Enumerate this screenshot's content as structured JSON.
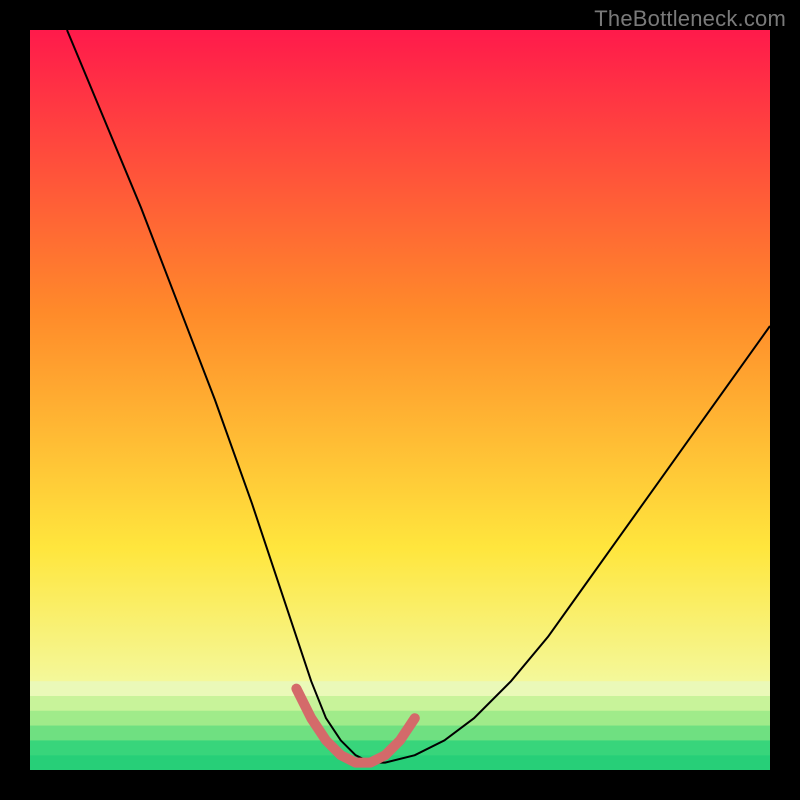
{
  "watermark": "TheBottleneck.com",
  "chart_data": {
    "type": "line",
    "title": "",
    "xlabel": "",
    "ylabel": "",
    "xlim": [
      0,
      100
    ],
    "ylim": [
      0,
      100
    ],
    "legend": false,
    "grid": false,
    "background_gradient": {
      "top_color": "#ff1a4b",
      "mid_color": "#ffe63d",
      "bottom_color": "#27e07a"
    },
    "series": [
      {
        "name": "bottleneck-curve",
        "color": "#000000",
        "stroke_width": 2,
        "x": [
          5,
          10,
          15,
          20,
          25,
          30,
          33,
          36,
          38,
          40,
          42,
          44,
          46,
          48,
          52,
          56,
          60,
          65,
          70,
          75,
          80,
          85,
          90,
          95,
          100
        ],
        "values": [
          100,
          88,
          76,
          63,
          50,
          36,
          27,
          18,
          12,
          7,
          4,
          2,
          1,
          1,
          2,
          4,
          7,
          12,
          18,
          25,
          32,
          39,
          46,
          53,
          60
        ]
      },
      {
        "name": "optimal-range-highlight",
        "color": "#d46a6a",
        "stroke_width": 10,
        "x": [
          36,
          38,
          40,
          42,
          44,
          46,
          48,
          50,
          52
        ],
        "values": [
          11,
          7,
          4,
          2,
          1,
          1,
          2,
          4,
          7
        ]
      }
    ],
    "bottom_stripes": {
      "colors": [
        "#eaf9b8",
        "#c8f39a",
        "#a0eb8a",
        "#6fe081",
        "#38d57b",
        "#27cf78"
      ],
      "ystart": 12,
      "ystep": 2
    }
  }
}
